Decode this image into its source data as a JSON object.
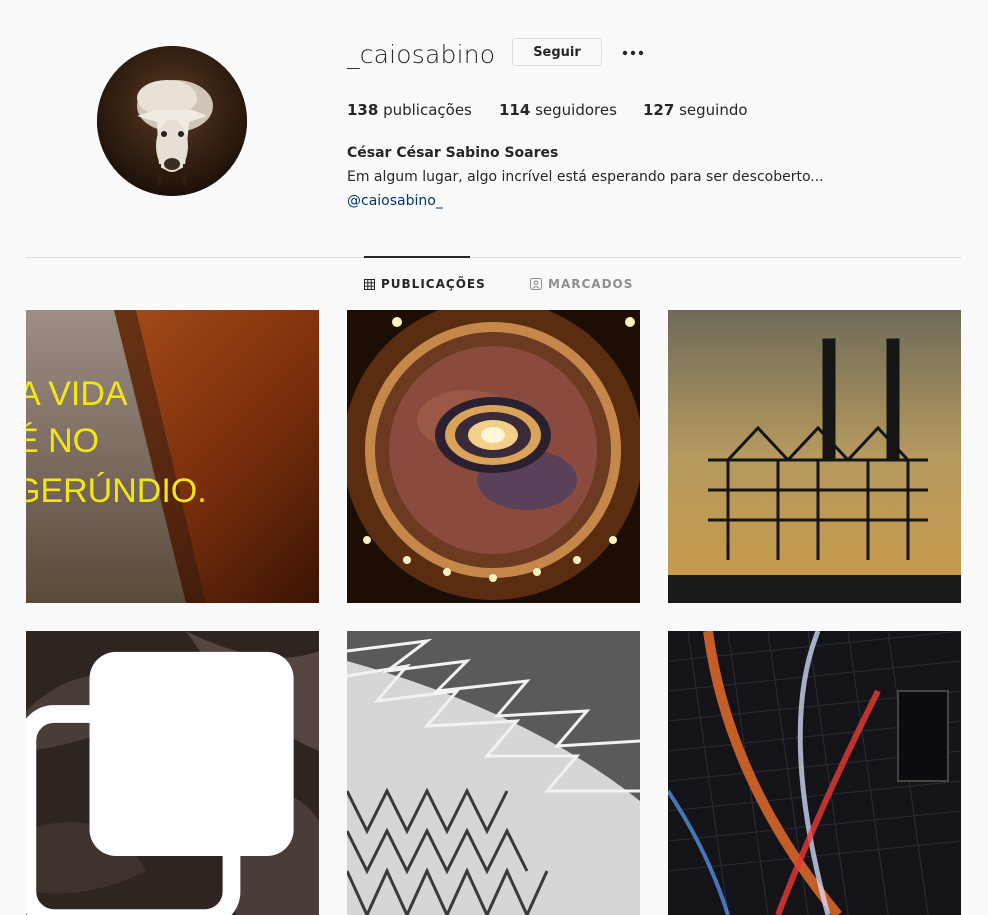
{
  "profile": {
    "username": "_caiosabino",
    "follow_label": "Seguir",
    "posts_count": "138",
    "posts_label": " publicações",
    "followers_count": "114",
    "followers_label": " seguidores",
    "following_count": "127",
    "following_label": " seguindo",
    "full_name": "César César Sabino Soares",
    "bio": "Em algum lugar, algo incrível está esperando para ser descoberto...",
    "link": "@caiosabino_"
  },
  "tabs": [
    {
      "label": "PUBLICAÇÕES",
      "icon": "grid-icon",
      "active": true
    },
    {
      "label": "MARCADOS",
      "icon": "tagged-icon",
      "active": false
    }
  ],
  "posts": [
    {
      "subject": "wall-graffiti",
      "caption_text": [
        "A VIDA",
        "É NO",
        "GERÚNDIO."
      ]
    },
    {
      "subject": "theater-ceiling"
    },
    {
      "subject": "port-cranes"
    },
    {
      "subject": "orange-flower",
      "multi": true
    },
    {
      "subject": "architecture-bw"
    },
    {
      "subject": "neon-lights"
    }
  ],
  "colors": {
    "background": "#fafafa",
    "text": "#262626",
    "muted": "#8e8e8e",
    "link": "#00376b",
    "border": "#dbdbdb"
  }
}
